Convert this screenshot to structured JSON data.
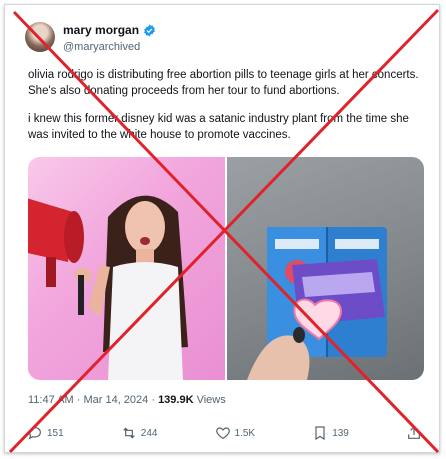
{
  "author": {
    "name": "mary morgan",
    "handle": "@maryarchived"
  },
  "tweet": {
    "paragraph_1": "olivia rodrigo is distributing free abortion pills to teenage girls at her concerts. She's also donating proceeds from her tour to fund abortions.",
    "paragraph_2": "i knew this former disney kid was a satanic industry plant from the time she was invited to the white house to promote vaccines."
  },
  "meta": {
    "time": "11:47 AM",
    "separator_1": " · ",
    "date": "Mar 14, 2024",
    "separator_2": " · ",
    "views_count": "139.9K",
    "views_label": " Views"
  },
  "actions": {
    "replies": "151",
    "reposts": "244",
    "likes": "1.5K",
    "bookmarks": "139"
  },
  "colors": {
    "overlay_x": "#e0232a",
    "verified": "#1d9bf0"
  }
}
